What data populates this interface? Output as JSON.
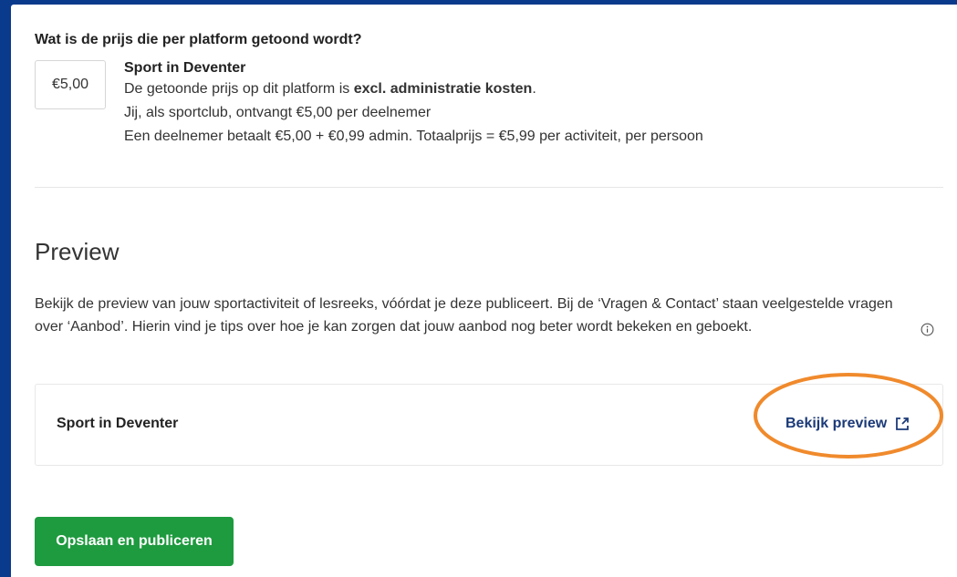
{
  "pricing": {
    "question": "Wat is de prijs die per platform getoond wordt?",
    "price_value": "€5,00",
    "platform_name": "Sport in Deventer",
    "line1_prefix": "De getoonde prijs op dit platform is ",
    "line1_bold": "excl. administratie kosten",
    "line1_suffix": ".",
    "line2": "Jij, als sportclub, ontvangt €5,00 per deelnemer",
    "line3": "Een deelnemer betaalt €5,00 + €0,99 admin. Totaalprijs = €5,99 per activiteit, per persoon"
  },
  "preview": {
    "title": "Preview",
    "description": "Bekijk de preview van jouw sportactiviteit of lesreeks, vóórdat je deze publiceert. Bij de ‘Vragen & Contact’ staan veelgestelde vragen over ‘Aanbod’. Hierin vind je tips over hoe je kan zorgen dat jouw aanbod nog beter wordt bekeken en geboekt.",
    "card_name": "Sport in Deventer",
    "link_label": "Bekijk preview"
  },
  "actions": {
    "publish_label": "Opslaan en publiceren"
  },
  "colors": {
    "background": "#0a3a8c",
    "primary_button": "#1e9a3f",
    "link": "#1b3a78",
    "highlight": "#f08a2c"
  },
  "icons": {
    "info": "info-icon",
    "external_link": "external-link-icon"
  }
}
